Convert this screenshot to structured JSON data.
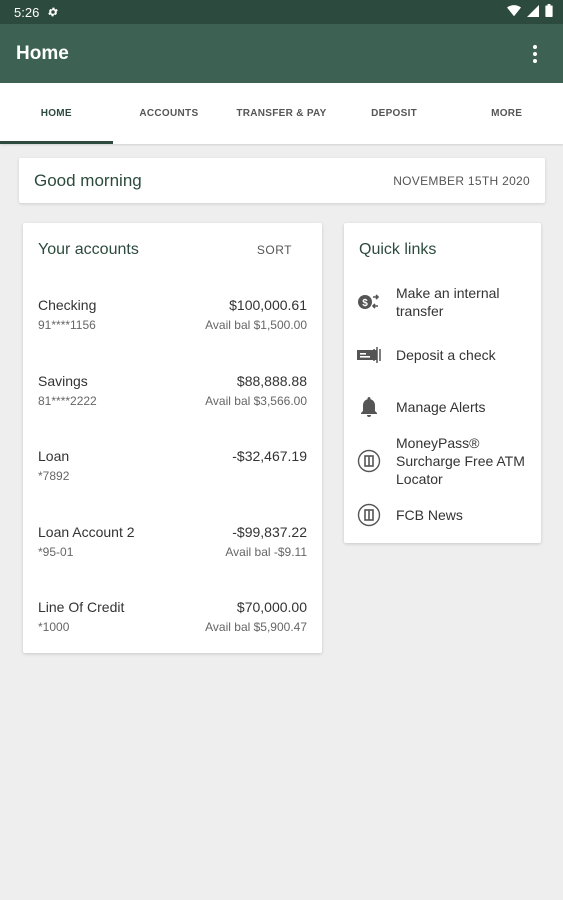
{
  "status_bar": {
    "time": "5:26"
  },
  "app_bar": {
    "title": "Home"
  },
  "tabs": [
    {
      "label": "HOME",
      "active": true
    },
    {
      "label": "ACCOUNTS"
    },
    {
      "label": "TRANSFER & PAY"
    },
    {
      "label": "DEPOSIT"
    },
    {
      "label": "MORE"
    }
  ],
  "greeting": {
    "text": "Good morning",
    "date": "NOVEMBER 15TH 2020"
  },
  "accounts": {
    "title": "Your accounts",
    "sort_label": "SORT",
    "items": [
      {
        "name": "Checking",
        "number": "91****1156",
        "balance": "$100,000.61",
        "avail": "Avail bal $1,500.00"
      },
      {
        "name": "Savings",
        "number": "81****2222",
        "balance": "$88,888.88",
        "avail": "Avail bal $3,566.00"
      },
      {
        "name": "Loan",
        "number": "*7892",
        "balance": "-$32,467.19",
        "avail": ""
      },
      {
        "name": "Loan Account 2",
        "number": "*95-01",
        "balance": "-$99,837.22",
        "avail": "Avail bal -$9.11"
      },
      {
        "name": "Line Of Credit",
        "number": "*1000",
        "balance": "$70,000.00",
        "avail": "Avail bal $5,900.47"
      }
    ]
  },
  "quick_links": {
    "title": "Quick links",
    "items": [
      {
        "label_lines": [
          "Make an internal",
          "transfer"
        ],
        "icon": "transfer-icon"
      },
      {
        "label_lines": [
          "Deposit a check"
        ],
        "icon": "check-icon"
      },
      {
        "label_lines": [
          "Manage Alerts"
        ],
        "icon": "bell-icon"
      },
      {
        "label_lines": [
          "MoneyPass®",
          "Surcharge Free ATM",
          "Locator"
        ],
        "icon": "external-link-icon"
      },
      {
        "label_lines": [
          "FCB News"
        ],
        "icon": "external-link-icon"
      }
    ]
  },
  "colors": {
    "primary_dark": "#2d4a3e",
    "primary": "#3d6153",
    "background": "#eeeeee"
  }
}
